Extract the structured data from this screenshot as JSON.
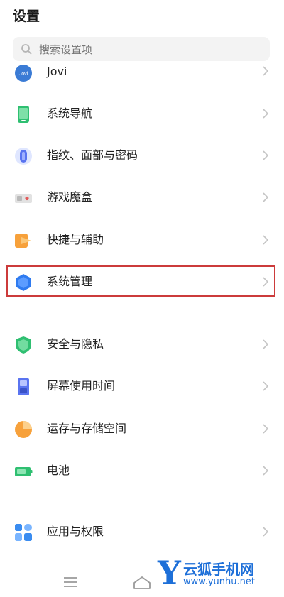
{
  "header": {
    "title": "设置"
  },
  "search": {
    "placeholder": "搜索设置项"
  },
  "items": [
    {
      "label": "Jovi",
      "icon": "jovi-icon"
    },
    {
      "label": "系统导航",
      "icon": "phone-navigation-icon"
    },
    {
      "label": "指纹、面部与密码",
      "icon": "fingerprint-icon"
    },
    {
      "label": "游戏魔盒",
      "icon": "game-box-icon"
    },
    {
      "label": "快捷与辅助",
      "icon": "shortcut-arrow-icon"
    },
    {
      "label": "系统管理",
      "icon": "hexagon-system-icon"
    },
    {
      "label": "安全与隐私",
      "icon": "shield-icon"
    },
    {
      "label": "屏幕使用时间",
      "icon": "hourglass-icon"
    },
    {
      "label": "运存与存储空间",
      "icon": "pie-storage-icon"
    },
    {
      "label": "电池",
      "icon": "battery-icon"
    },
    {
      "label": "应用与权限",
      "icon": "apps-grid-icon"
    }
  ],
  "watermark": {
    "brand": "云狐手机网",
    "url": "www.yunhu.net",
    "letter": "Y"
  },
  "colors": {
    "highlight": "#cc3b3b",
    "watermark": "#1d6fd8",
    "chevron": "#c4c4c4"
  }
}
